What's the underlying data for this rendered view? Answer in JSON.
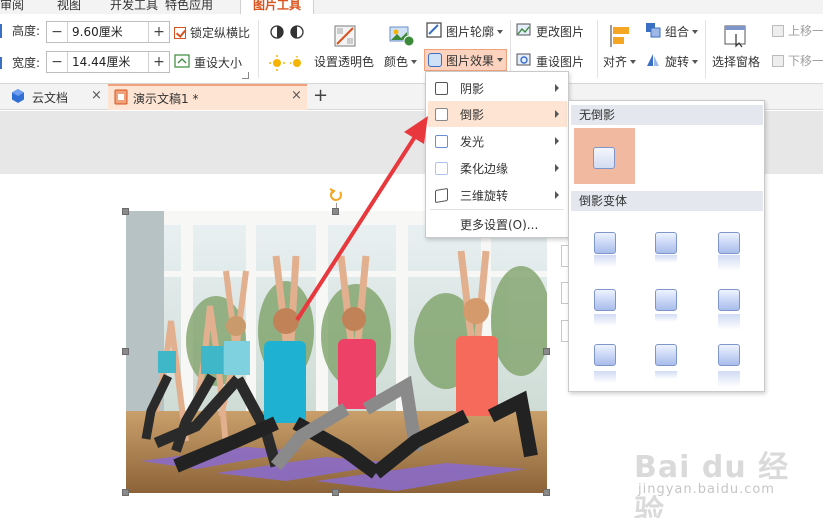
{
  "menu_tabs": [
    "审阅",
    "视图",
    "开发工具",
    "特色应用",
    "图片工具"
  ],
  "ribbon": {
    "height_label": "高度:",
    "height_value": "9.60厘米",
    "width_label": "宽度:",
    "width_value": "14.44厘米",
    "minus": "−",
    "plus": "+",
    "lock_ratio": "锁定纵横比",
    "reset_size": "重设大小",
    "set_transparent": "设置透明色",
    "color": "颜色",
    "outline": "图片轮廓",
    "effects": "图片效果",
    "change_picture": "更改图片",
    "reset_picture": "重设图片",
    "align": "对齐",
    "group": "组合",
    "rotate": "旋转",
    "selection_pane": "选择窗格",
    "bring_forward": "上移一",
    "send_backward": "下移一"
  },
  "doc_tabs": [
    {
      "label": "云文档"
    },
    {
      "label": "演示文稿1 *"
    }
  ],
  "close_glyph": "×",
  "new_tab_glyph": "+",
  "effects_menu": {
    "items": [
      "阴影",
      "倒影",
      "发光",
      "柔化边缘",
      "三维旋转",
      "更多设置(O)..."
    ],
    "active": "倒影"
  },
  "reflection_panel": {
    "no_reflection": "无倒影",
    "variants": "倒影变体"
  },
  "colors": {
    "accent": "#d9531e",
    "highlight": "#fde4d3",
    "arrow": "#e8383d"
  },
  "watermark": {
    "logo": "Bai du 经验",
    "url": "jingyan.baidu.com"
  }
}
